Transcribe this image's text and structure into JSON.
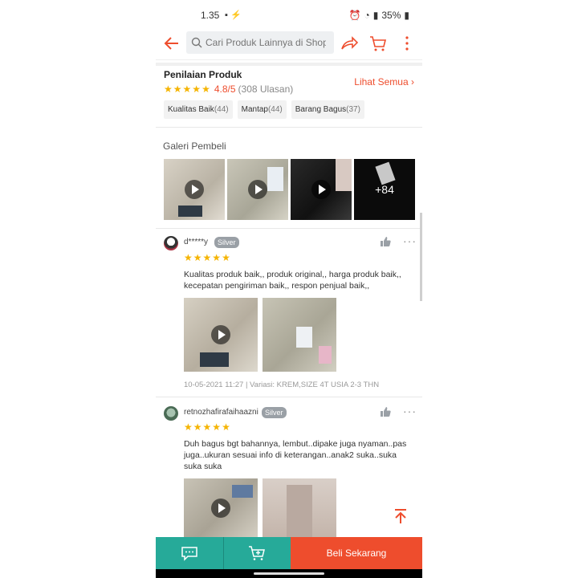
{
  "status": {
    "time": "1.35",
    "battery": "35%"
  },
  "search": {
    "placeholder": "Cari Produk Lainnya di Shop..."
  },
  "rating": {
    "title": "Penilaian Produk",
    "score": "4.8/5",
    "count": "(308 Ulasan)",
    "see_all": "Lihat Semua",
    "tags": [
      {
        "label": "Kualitas Baik",
        "count": "(44)"
      },
      {
        "label": "Mantap",
        "count": "(44)"
      },
      {
        "label": "Barang Bagus",
        "count": "(37)"
      }
    ]
  },
  "gallery": {
    "title": "Galeri Pembeli",
    "more": "+84"
  },
  "reviews": [
    {
      "user": "d*****y",
      "badge": "Silver",
      "text": "Kualitas produk baik,, produk original,, harga produk baik,, kecepatan pengiriman baik,, respon penjual baik,,",
      "meta": "10-05-2021 11:27 | Variasi: KREM,SIZE 4T USIA 2-3 THN"
    },
    {
      "user": "retnozhafirafaihaazni",
      "badge": "Silver",
      "text": "Duh bagus bgt bahannya, lembut..dipake juga nyaman..pas juga..ukuran sesuai info di keterangan..anak2 suka..suka suka suka"
    }
  ],
  "bottom": {
    "buy_label": "Beli Sekarang"
  },
  "colors": {
    "accent": "#ee4d2d",
    "teal": "#26aa99",
    "star": "#f5b400"
  }
}
